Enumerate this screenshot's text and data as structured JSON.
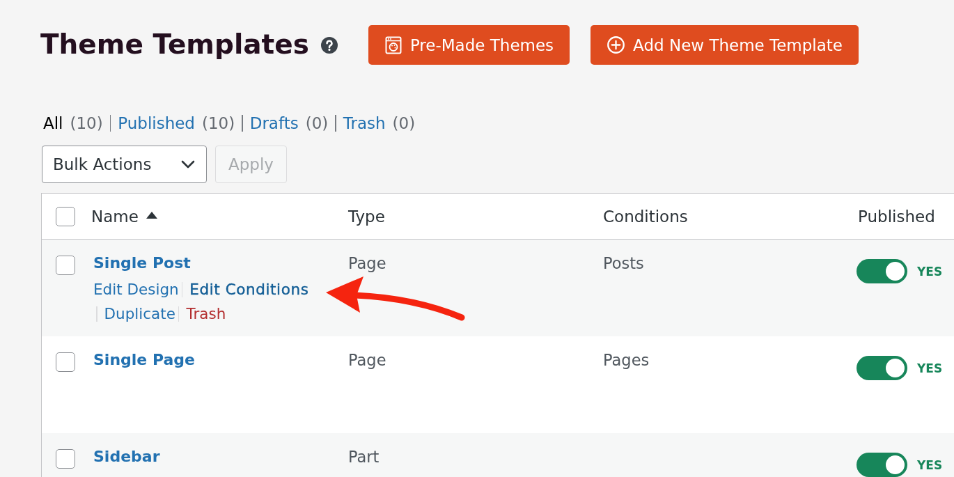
{
  "header": {
    "title": "Theme Templates",
    "buttons": [
      {
        "label": "Pre-Made Themes",
        "kind": "themes"
      },
      {
        "label": "Add New Theme Template",
        "kind": "add"
      }
    ]
  },
  "filters": [
    {
      "label": "All",
      "count": "(10)",
      "selected": true
    },
    {
      "label": "Published",
      "count": "(10)",
      "selected": false
    },
    {
      "label": "Drafts",
      "count": "(0)",
      "selected": false
    },
    {
      "label": "Trash",
      "count": "(0)",
      "selected": false
    }
  ],
  "bulk_actions": {
    "value": "Bulk Actions",
    "apply_label": "Apply",
    "apply_disabled": true
  },
  "table": {
    "select_all_checked": false,
    "columns": [
      {
        "label": "Name",
        "sorted": true
      },
      {
        "label": "Type",
        "sorted": false
      },
      {
        "label": "Conditions",
        "sorted": false
      },
      {
        "label": "Published",
        "sorted": false
      }
    ],
    "rows": [
      {
        "name": "Single Post",
        "checked": false,
        "actions": [
          {
            "label": "Edit Design",
            "kind": "edit",
            "hovered": false
          },
          {
            "label": "Edit Conditions",
            "kind": "edit",
            "hovered": true
          },
          {
            "label": "Duplicate",
            "kind": "edit",
            "hovered": false
          },
          {
            "label": "Trash",
            "kind": "delete",
            "hovered": false
          }
        ],
        "type": "Page",
        "conditions": "Posts",
        "published": true,
        "status": "YES"
      },
      {
        "name": "Single Page",
        "checked": false,
        "type": "Page",
        "conditions": "Pages",
        "published": true,
        "status": "YES"
      },
      {
        "name": "Sidebar",
        "checked": false,
        "type": "Part",
        "published": true,
        "status": "YES"
      }
    ]
  },
  "annotation": {
    "kind": "arrow"
  }
}
